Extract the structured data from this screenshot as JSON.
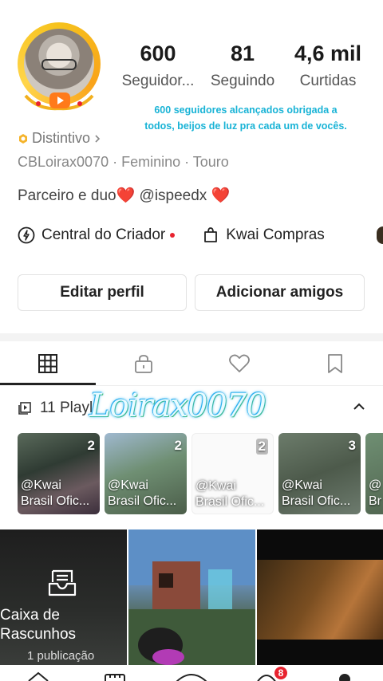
{
  "profile": {
    "stats": {
      "followers_value": "600",
      "followers_label": "Seguidor...",
      "following_value": "81",
      "following_label": "Seguindo",
      "likes_value": "4,6 mil",
      "likes_label": "Curtidas"
    },
    "announcement_line1": "600 seguidores alcançados obrigada a",
    "announcement_line2": "todos, beijos de luz pra cada um de vocês.",
    "badge_label": "Distintivo",
    "info_line": "CBLoirax0070 · Feminino · Touro",
    "bio_text": "Parceiro e duo",
    "bio_mention": " @ispeedx ",
    "heart": "❤️"
  },
  "shortcuts": {
    "creator_center": "Central do Criador",
    "kwai_shop": "Kwai Compras"
  },
  "buttons": {
    "edit_profile": "Editar perfil",
    "add_friends": "Adicionar amigos"
  },
  "tabs": [
    "grid-icon",
    "lock-icon",
    "heart-icon",
    "bookmark-icon"
  ],
  "playlists": {
    "label": "11 Playl",
    "watermark": "Loirax0070",
    "items": [
      {
        "count": "2",
        "caption_line1": "@Kwai",
        "caption_line2": "Brasil Ofic..."
      },
      {
        "count": "2",
        "caption_line1": "@Kwai",
        "caption_line2": "Brasil Ofic..."
      },
      {
        "count": "2",
        "caption_line1": "@Kwai",
        "caption_line2": "Brasil Ofic..."
      },
      {
        "count": "3",
        "caption_line1": "@Kwai",
        "caption_line2": "Brasil Ofic..."
      },
      {
        "count": "",
        "caption_line1": "@",
        "caption_line2": "Br"
      }
    ]
  },
  "grid": {
    "drafts_title_line1": "Caixa de",
    "drafts_title_line2": "Rascunhos",
    "drafts_count": "1 publicação"
  },
  "bottom_nav": {
    "messages_badge": "8"
  },
  "colors": {
    "accent_cyan": "#18b3d6",
    "badge_red": "#e8232f",
    "ring_gold": "#f6c21c"
  }
}
